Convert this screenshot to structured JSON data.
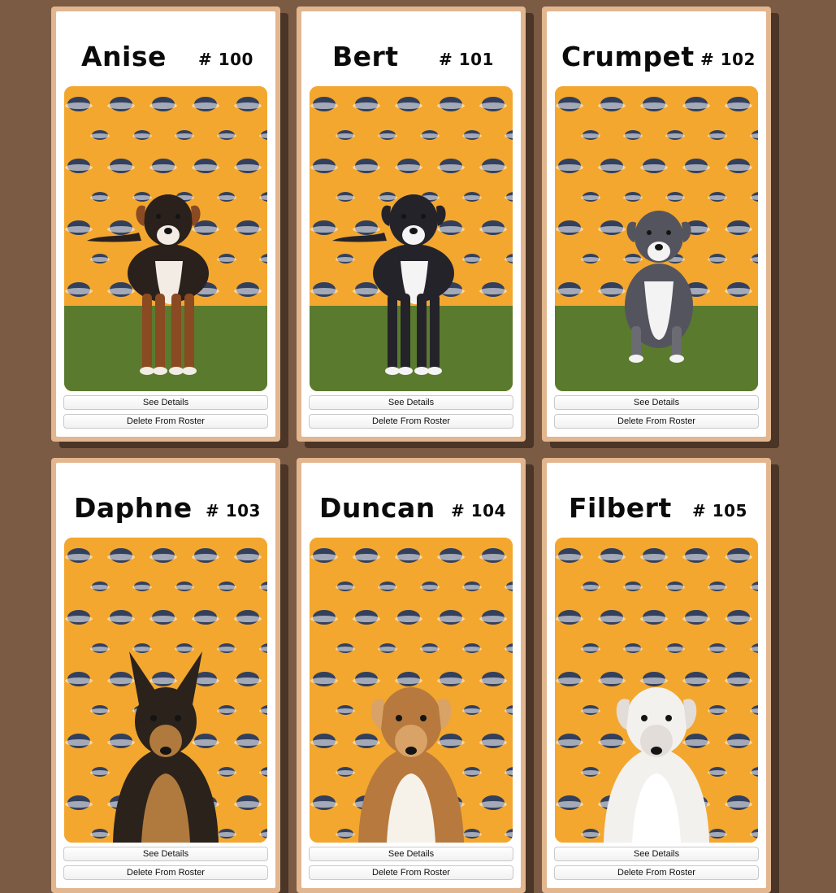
{
  "roster": [
    {
      "name": "Anise",
      "number": "# 100",
      "breed_look": "brown-black-mix",
      "details_label": "See Details",
      "delete_label": "Delete From Roster"
    },
    {
      "name": "Bert",
      "number": "# 101",
      "breed_look": "black-white-pointer",
      "details_label": "See Details",
      "delete_label": "Delete From Roster"
    },
    {
      "name": "Crumpet",
      "number": "# 102",
      "breed_look": "blue-pit-puppy",
      "details_label": "See Details",
      "delete_label": "Delete From Roster"
    },
    {
      "name": "Daphne",
      "number": "# 103",
      "breed_look": "german-shepherd",
      "details_label": "See Details",
      "delete_label": "Delete From Roster"
    },
    {
      "name": "Duncan",
      "number": "# 104",
      "breed_look": "rough-collie",
      "details_label": "See Details",
      "delete_label": "Delete From Roster"
    },
    {
      "name": "Filbert",
      "number": "# 105",
      "breed_look": "white-fluffy",
      "details_label": "See Details",
      "delete_label": "Delete From Roster"
    }
  ],
  "colors": {
    "page_background": "#7b5b44",
    "card_border": "#e2b68f",
    "card_shadow": "#4a3527",
    "photo_backdrop": "#f3a72f",
    "logo_navy": "#1e3563",
    "grass": "#5a7a2e"
  },
  "icons": {
    "backdrop_logo": "pedigree-logo-icon",
    "puppy_photo": "puppy-photo"
  }
}
